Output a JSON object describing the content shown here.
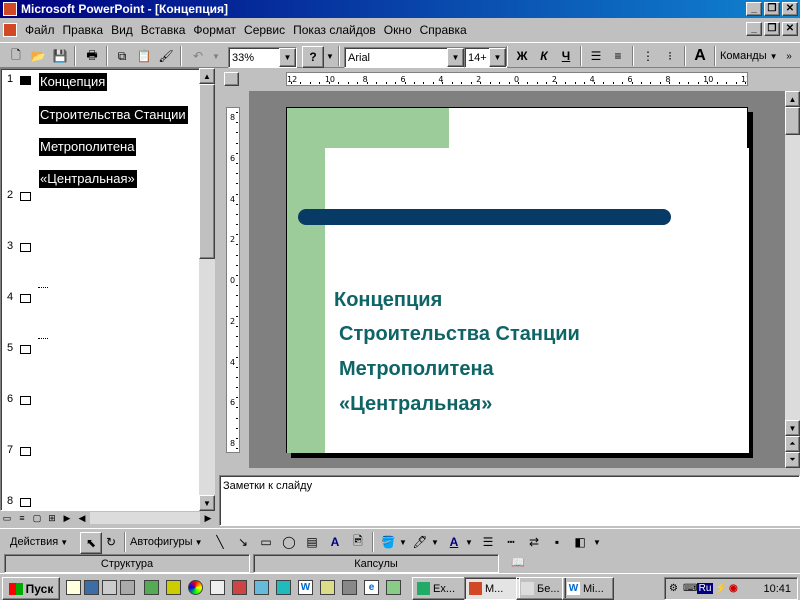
{
  "window": {
    "title": "Microsoft PowerPoint - [Концепция]"
  },
  "menu": [
    "Файл",
    "Правка",
    "Вид",
    "Вставка",
    "Формат",
    "Сервис",
    "Показ слайдов",
    "Окно",
    "Справка"
  ],
  "toolbar": {
    "zoom": "33%",
    "font": "Arial",
    "font_size": "14+",
    "bold": "Ж",
    "italic": "К",
    "underline": "Ч",
    "commands": "Команды"
  },
  "outline": {
    "slides": [
      {
        "num": "1",
        "lines": [
          "Концепция",
          "Строительства Станции",
          "Метрополитена",
          "«Центральная»"
        ]
      },
      {
        "num": "2"
      },
      {
        "num": "3"
      },
      {
        "num": "4"
      },
      {
        "num": "5"
      },
      {
        "num": "6"
      },
      {
        "num": "7"
      },
      {
        "num": "8"
      }
    ]
  },
  "slide": {
    "title_lines": [
      "Концепция",
      "Строительства Станции",
      "Метрополитена",
      "«Центральная»"
    ],
    "colors": {
      "title": "#0f6466",
      "green_bar": "#9ccc99",
      "blue_line": "#083a66"
    }
  },
  "rulers": {
    "horizontal": [
      "12",
      "10",
      "8",
      "6",
      "4",
      "2",
      "0",
      "2",
      "4",
      "6",
      "8",
      "10",
      "12"
    ],
    "vertical": [
      "8",
      "6",
      "4",
      "2",
      "0",
      "2",
      "4",
      "6",
      "8"
    ]
  },
  "notes": {
    "placeholder": "Заметки к слайду"
  },
  "drawing": {
    "actions": "Действия",
    "autoshapes": "Автофигуры"
  },
  "status": {
    "view": "Структура",
    "design": "Капсулы"
  },
  "taskbar": {
    "start": "Пуск",
    "tasks": [
      "Ex...",
      "M...",
      "Бе...",
      "Mi..."
    ],
    "lang": "Ru",
    "clock": "10:41"
  }
}
